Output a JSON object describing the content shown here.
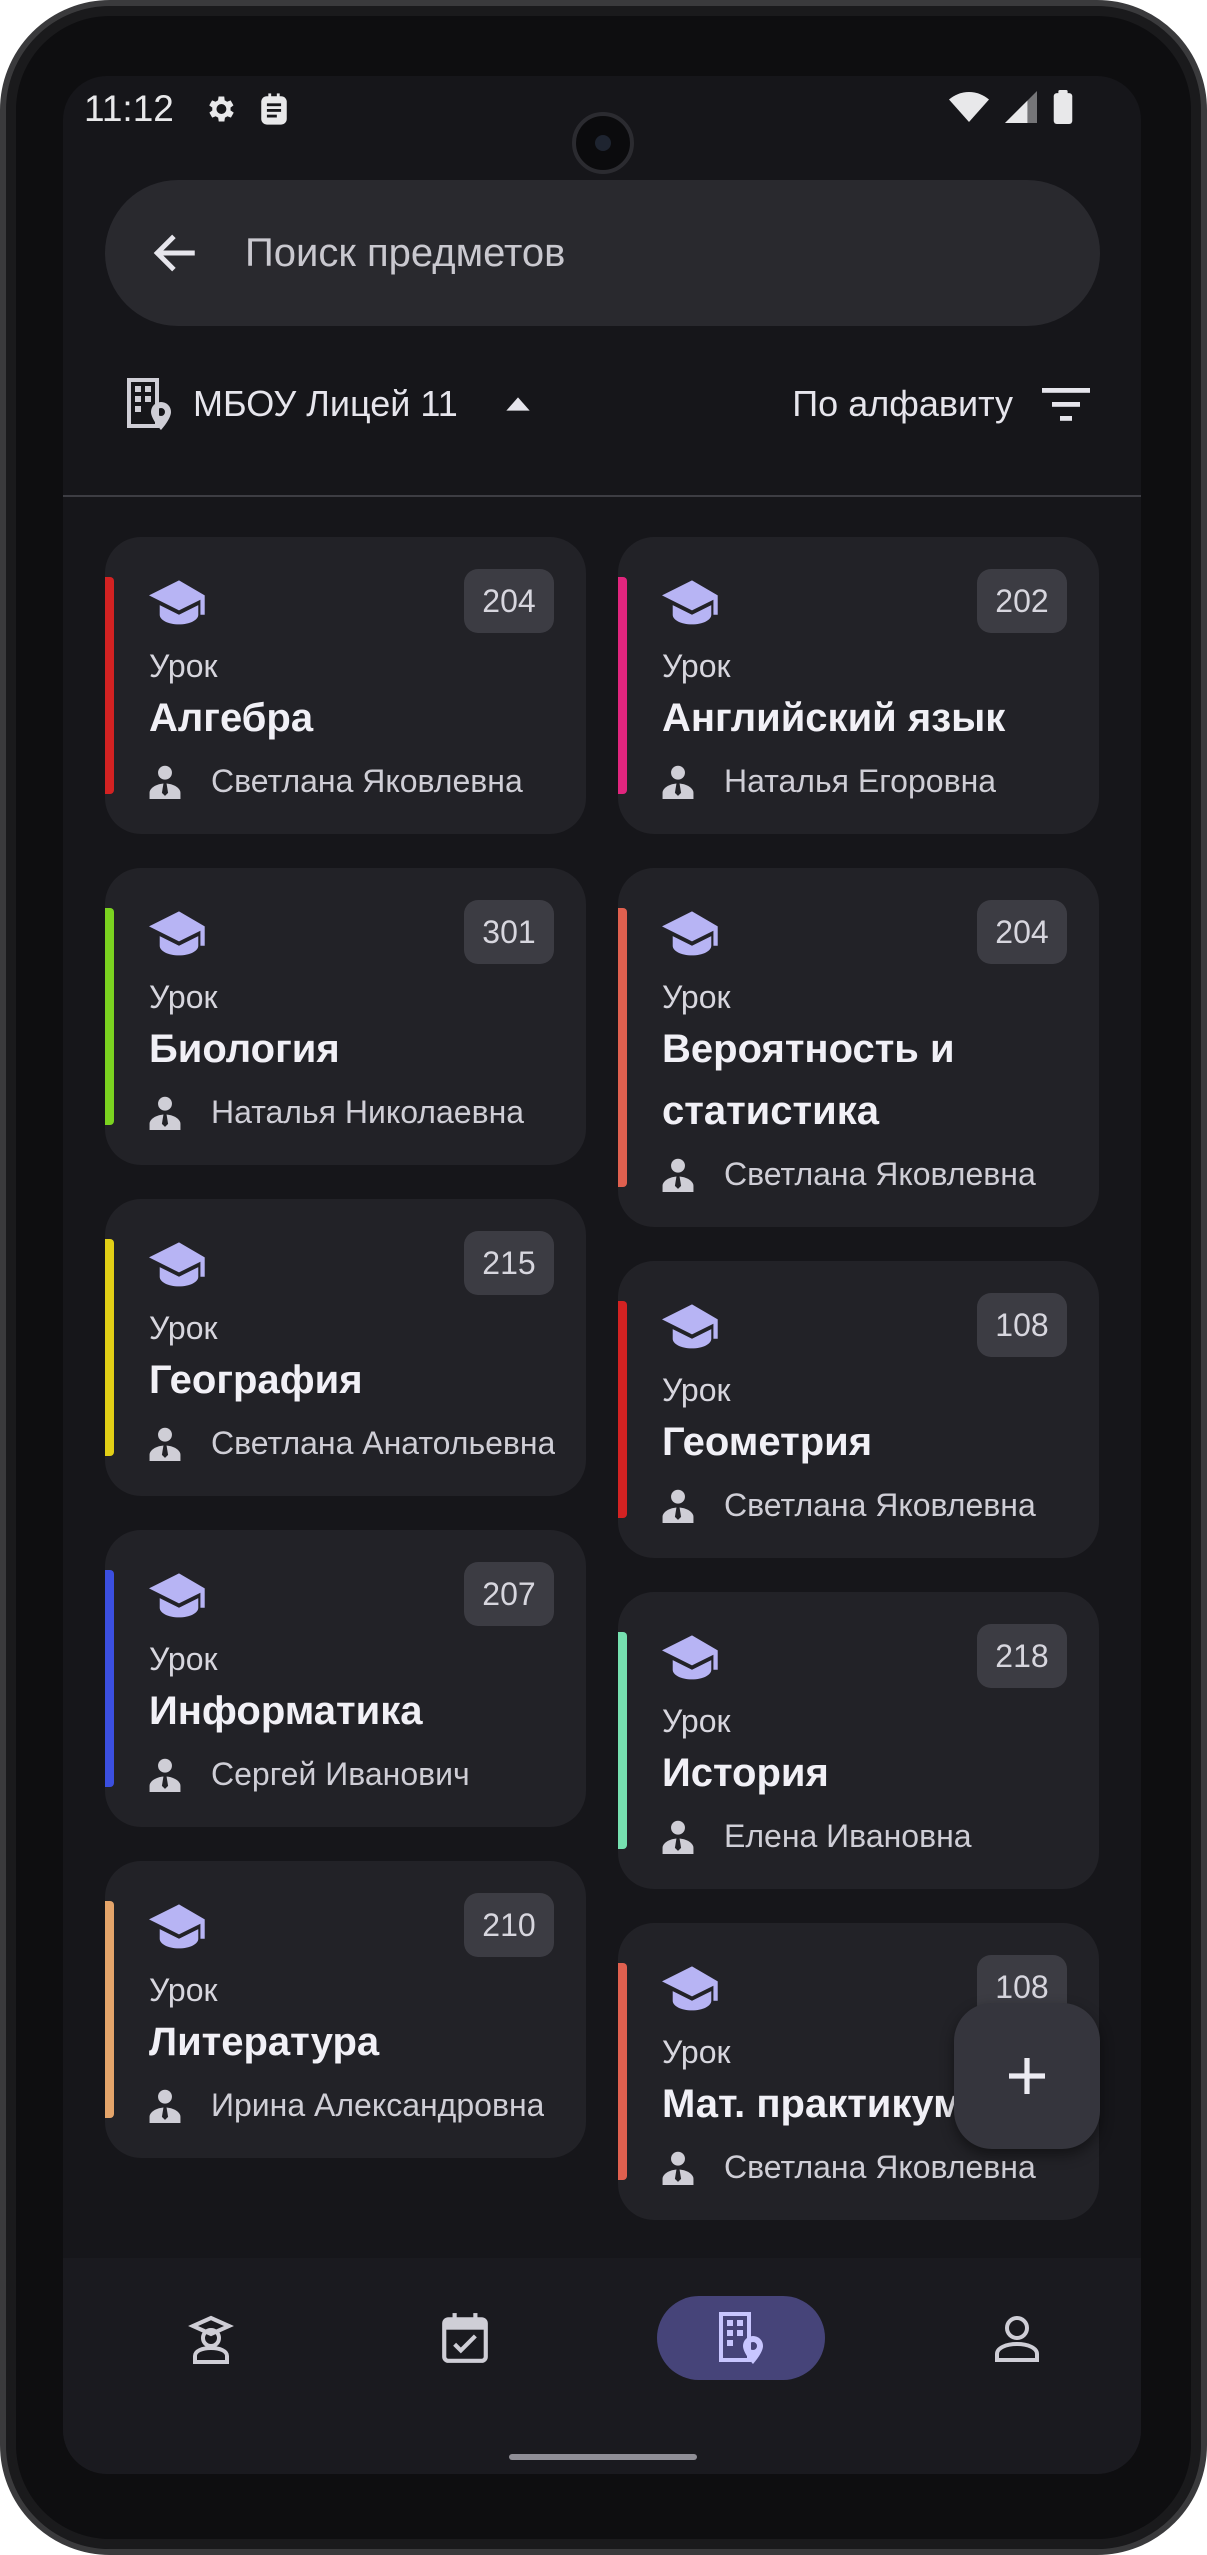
{
  "status_bar": {
    "time": "11:12"
  },
  "search": {
    "placeholder": "Поиск предметов"
  },
  "filters": {
    "school": "МБОУ Лицей 11",
    "sort": "По алфавиту"
  },
  "cards_left": [
    {
      "room": "204",
      "type": "Урок",
      "title": "Алгебра",
      "teacher": "Светлана Яковлевна",
      "color": "#d32222"
    },
    {
      "room": "301",
      "type": "Урок",
      "title": "Биология",
      "teacher": "Наталья Николаевна",
      "color": "#7bd320"
    },
    {
      "room": "215",
      "type": "Урок",
      "title": "География",
      "teacher": "Светлана Анатольевна",
      "color": "#e2cf16"
    },
    {
      "room": "207",
      "type": "Урок",
      "title": "Информатика",
      "teacher": "Сергей Иванович",
      "color": "#3b4fe0"
    },
    {
      "room": "210",
      "type": "Урок",
      "title": "Литература",
      "teacher": "Ирина Александровна",
      "color": "#e4a46a"
    }
  ],
  "cards_right": [
    {
      "room": "202",
      "type": "Урок",
      "title": "Английский язык",
      "teacher": "Наталья Егоровна",
      "color": "#e2257e"
    },
    {
      "room": "204",
      "type": "Урок",
      "title": "Вероятность и статистика",
      "teacher": "Светлана Яковлевна",
      "color": "#e0604f"
    },
    {
      "room": "108",
      "type": "Урок",
      "title": "Геометрия",
      "teacher": "Светлана Яковлевна",
      "color": "#d32222"
    },
    {
      "room": "218",
      "type": "Урок",
      "title": "История",
      "teacher": "Елена Ивановна",
      "color": "#76e0b0"
    },
    {
      "room": "108",
      "type": "Урок",
      "title": "Мат. практикум",
      "teacher": "Светлана Яковлевна",
      "color": "#e0604f"
    }
  ],
  "nav": {
    "items": [
      {
        "icon": "teacher-icon",
        "active": false
      },
      {
        "icon": "calendar-check-icon",
        "active": false
      },
      {
        "icon": "building-location-icon",
        "active": true
      },
      {
        "icon": "person-icon",
        "active": false
      }
    ]
  },
  "colors": {
    "accent_nav": "#464479",
    "icon_lavender": "#b7b4f4",
    "background": "#16161a",
    "card": "#222227"
  }
}
